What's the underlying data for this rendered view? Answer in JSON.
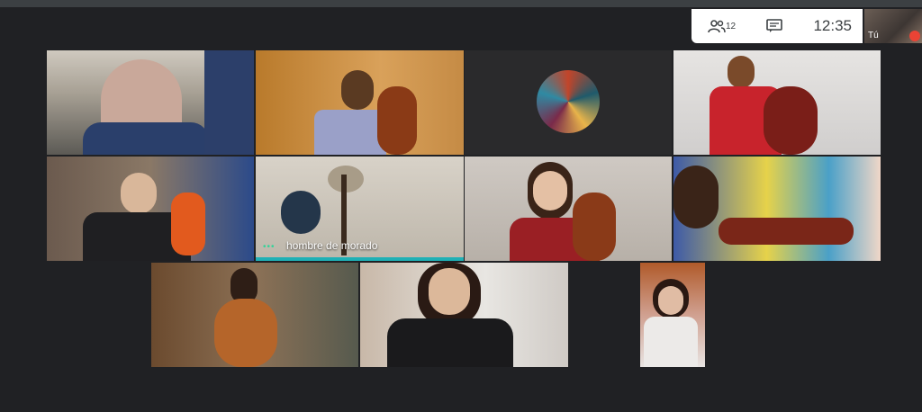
{
  "header": {
    "participant_count": "12",
    "time": "12:35",
    "self_label": "Tú"
  },
  "participants": [
    {
      "name": ""
    },
    {
      "name": ""
    },
    {
      "name": ""
    },
    {
      "name": ""
    },
    {
      "name": ""
    },
    {
      "name": "hombre de morado"
    },
    {
      "name": ""
    },
    {
      "name": ""
    },
    {
      "name": ""
    },
    {
      "name": ""
    },
    {
      "name": ""
    }
  ],
  "icons": {
    "participants": "people-icon",
    "chat": "chat-icon",
    "mic_off": "mic-off-icon"
  },
  "colors": {
    "background": "#202124",
    "active_speaker": "#1fb0b5",
    "mic_off": "#ea4335"
  }
}
